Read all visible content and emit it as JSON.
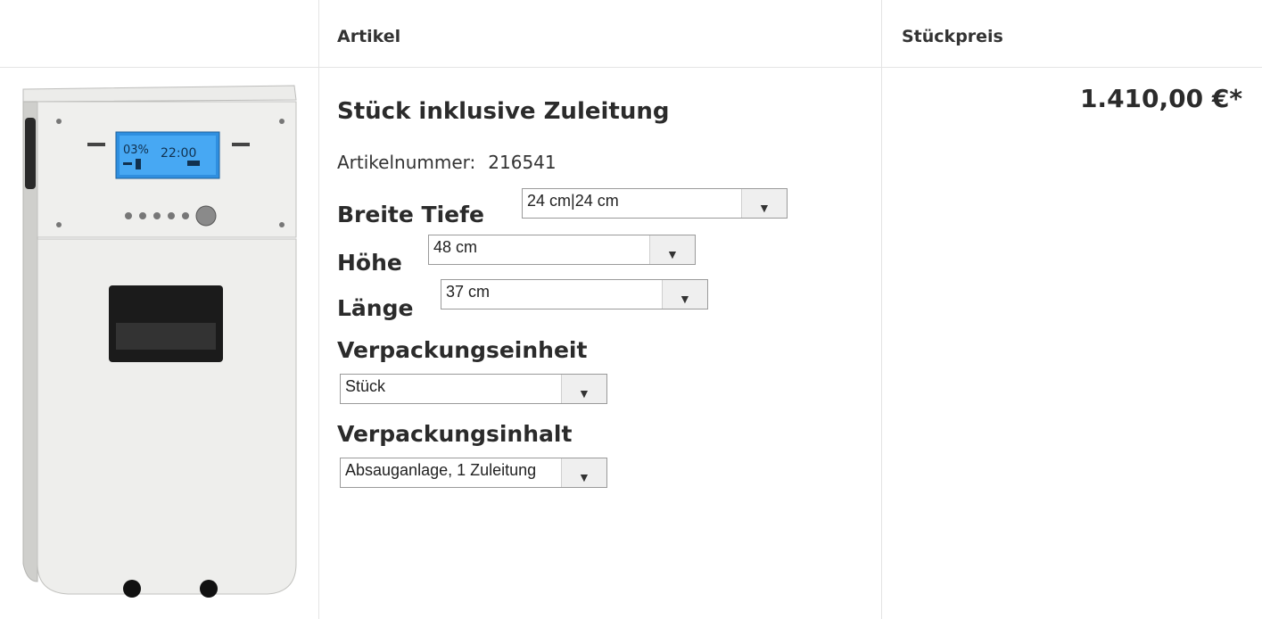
{
  "header": {
    "col_article": "Artikel",
    "col_price": "Stückpreis"
  },
  "product": {
    "title": "Stück inklusive Zuleitung",
    "article_number_label": "Artikelnummer:",
    "article_number": "216541",
    "price": "1.410,00 €*",
    "image_display": {
      "percent": "03%",
      "time": "22:00"
    }
  },
  "options": {
    "breite_tiefe": {
      "label": "Breite Tiefe",
      "value": "24 cm|24 cm"
    },
    "hoehe": {
      "label": "Höhe",
      "value": "48 cm"
    },
    "laenge": {
      "label": "Länge",
      "value": "37 cm"
    },
    "verpackungseinheit": {
      "label": "Verpackungseinheit",
      "value": "Stück"
    },
    "verpackungsinhalt": {
      "label": "Verpackungsinhalt",
      "value": "Absauganlage, 1 Zuleitung"
    }
  },
  "icons": {
    "dropdown": "triangle-down-icon"
  }
}
